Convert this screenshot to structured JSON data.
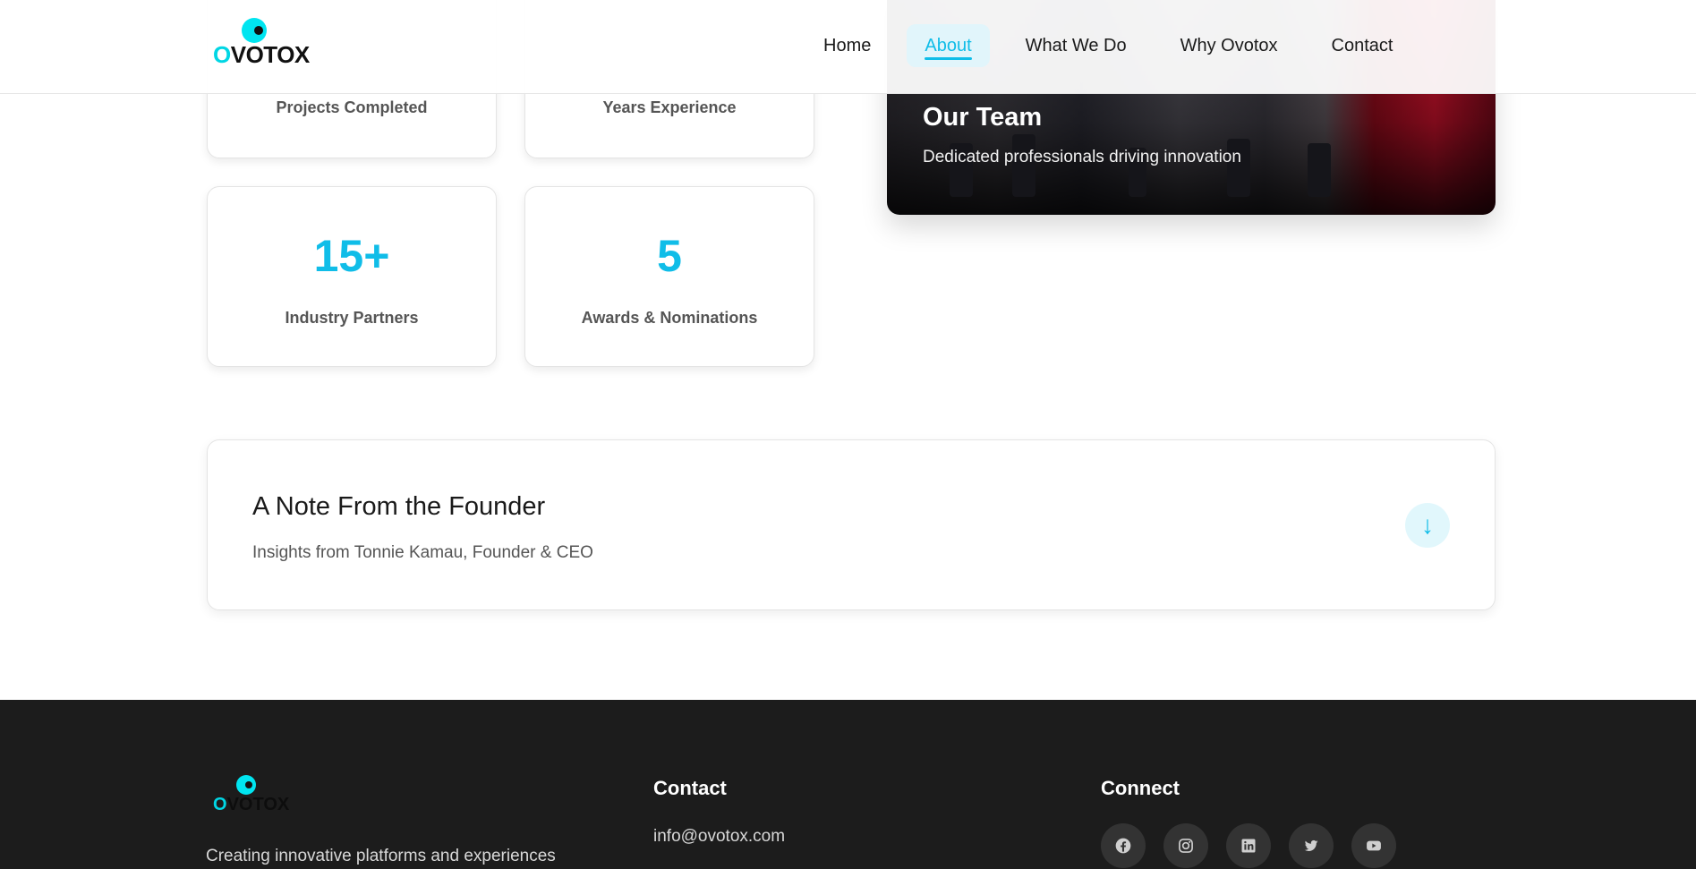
{
  "header": {
    "logo": {
      "first_letter": "O",
      "rest": "VOTOX"
    },
    "nav": [
      {
        "label": "Home"
      },
      {
        "label": "About",
        "active": true
      },
      {
        "label": "What We Do"
      },
      {
        "label": "Why Ovotox"
      },
      {
        "label": "Contact"
      }
    ]
  },
  "stats": [
    {
      "value": "",
      "label": "Projects Completed"
    },
    {
      "value": "",
      "label": "Years Experience"
    },
    {
      "value": "15+",
      "label": "Industry Partners"
    },
    {
      "value": "5",
      "label": "Awards & Nominations"
    }
  ],
  "team_card": {
    "title": "Our Team",
    "subtitle": "Dedicated professionals driving innovation"
  },
  "founder_note": {
    "title": "A Note From the Founder",
    "subtitle": "Insights from Tonnie Kamau, Founder & CEO",
    "toggle_icon": "↓"
  },
  "footer": {
    "logo": {
      "first_letter": "O",
      "rest": "VOTOX"
    },
    "tagline": "Creating innovative platforms and experiences",
    "contact": {
      "title": "Contact",
      "email": "info@ovotox.com"
    },
    "connect": {
      "title": "Connect",
      "socials": [
        "facebook-icon",
        "instagram-icon",
        "linkedin-icon",
        "twitter-icon",
        "youtube-icon"
      ]
    }
  },
  "colors": {
    "accent": "#10bde8",
    "logo_cyan": "#00e5f0",
    "footer_bg": "#1c1c1c"
  }
}
